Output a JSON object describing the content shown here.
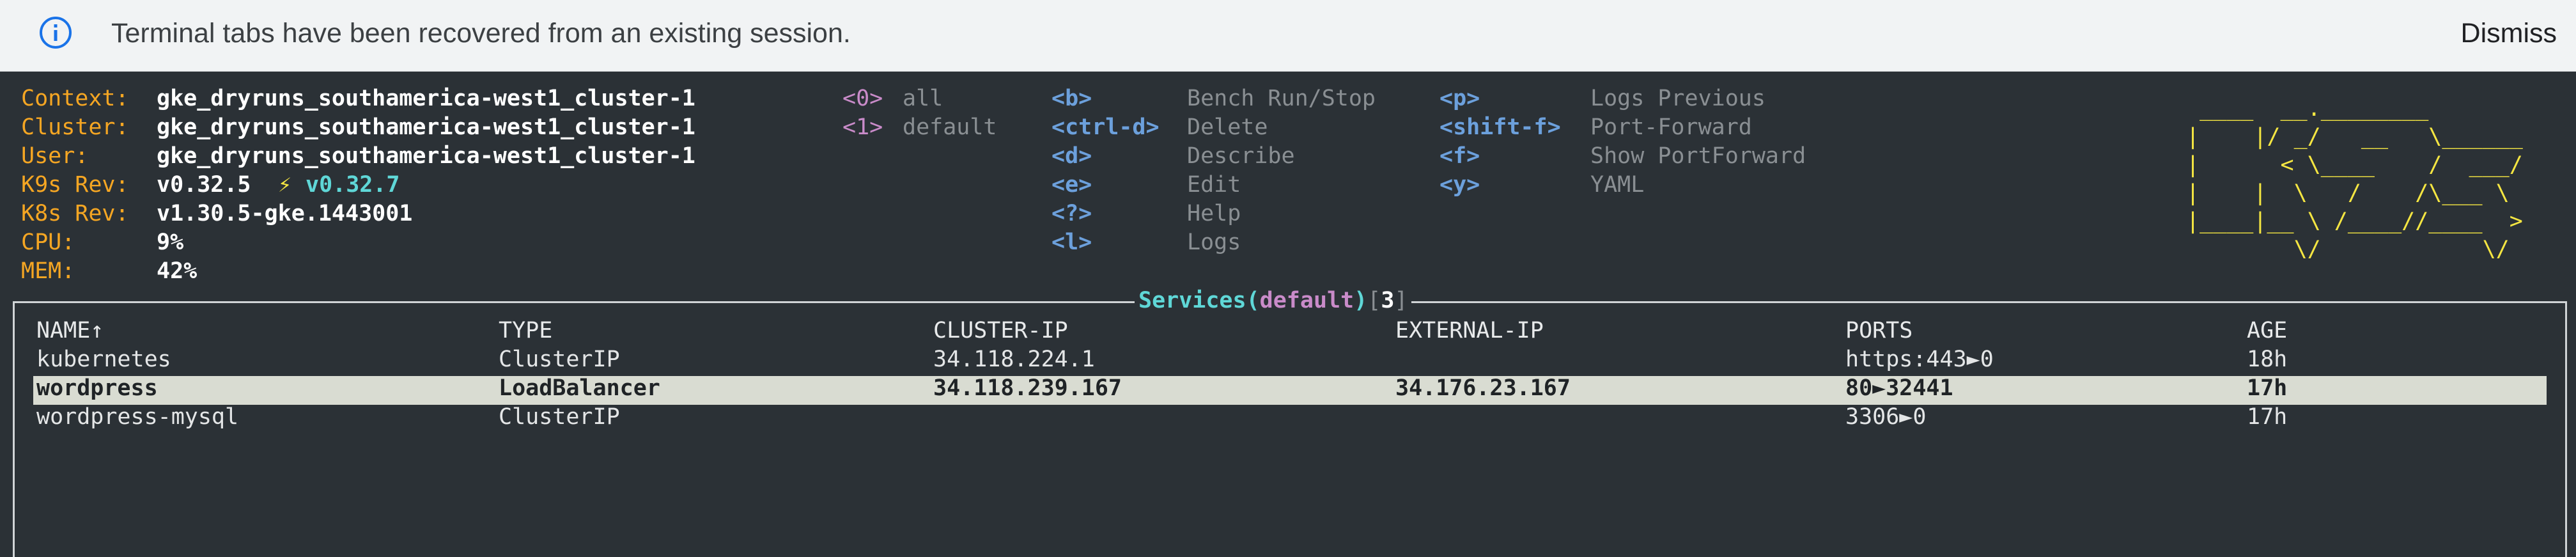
{
  "banner": {
    "message": "Terminal tabs have been recovered from an existing session.",
    "dismiss_label": "Dismiss",
    "icon": "info-icon"
  },
  "info": {
    "context_label": "Context:",
    "context_value": "gke_dryruns_southamerica-west1_cluster-1",
    "cluster_label": "Cluster:",
    "cluster_value": "gke_dryruns_southamerica-west1_cluster-1",
    "user_label": "User:",
    "user_value": "gke_dryruns_southamerica-west1_cluster-1",
    "k9s_label": "K9s Rev:",
    "k9s_value": "v0.32.5",
    "k9s_upgrade_icon": "⚡",
    "k9s_latest": "v0.32.7",
    "k8s_label": "K8s Rev:",
    "k8s_value": "v1.30.5-gke.1443001",
    "cpu_label": "CPU:",
    "cpu_value": "9%",
    "mem_label": "MEM:",
    "mem_value": "42%"
  },
  "namespaces": [
    {
      "key": "<0>",
      "label": "all"
    },
    {
      "key": "<1>",
      "label": "default"
    }
  ],
  "hotkeys_col1": [
    {
      "key": "<b>",
      "label": "Bench Run/Stop"
    },
    {
      "key": "<ctrl-d>",
      "label": "Delete"
    },
    {
      "key": "<d>",
      "label": "Describe"
    },
    {
      "key": "<e>",
      "label": "Edit"
    },
    {
      "key": "<?>",
      "label": "Help"
    },
    {
      "key": "<l>",
      "label": "Logs"
    }
  ],
  "hotkeys_col2": [
    {
      "key": "<p>",
      "label": "Logs Previous"
    },
    {
      "key": "<shift-f>",
      "label": "Port-Forward"
    },
    {
      "key": "<f>",
      "label": "Show PortForward"
    },
    {
      "key": "<y>",
      "label": "YAML"
    }
  ],
  "logo_lines": [
    " ____  __.________       ",
    "|    |/ _/   __   \\______",
    "|      < \\____    /  ___/",
    "|    |  \\   /    /\\___ \\ ",
    "|____|__ \\ /____//____  >",
    "        \\/            \\/ "
  ],
  "table": {
    "title_resource": "Services",
    "title_ns": "default",
    "title_count": "3",
    "columns": [
      "NAME↑",
      "TYPE",
      "CLUSTER-IP",
      "EXTERNAL-IP",
      "PORTS",
      "AGE"
    ],
    "rows": [
      [
        "kubernetes",
        "ClusterIP",
        "34.118.224.1",
        "",
        "https:443►0",
        "18h"
      ],
      [
        "wordpress",
        "LoadBalancer",
        "34.118.239.167",
        "34.176.23.167",
        "80►32441",
        "17h"
      ],
      [
        "wordpress-mysql",
        "ClusterIP",
        "",
        "",
        "3306►0",
        "17h"
      ]
    ]
  }
}
